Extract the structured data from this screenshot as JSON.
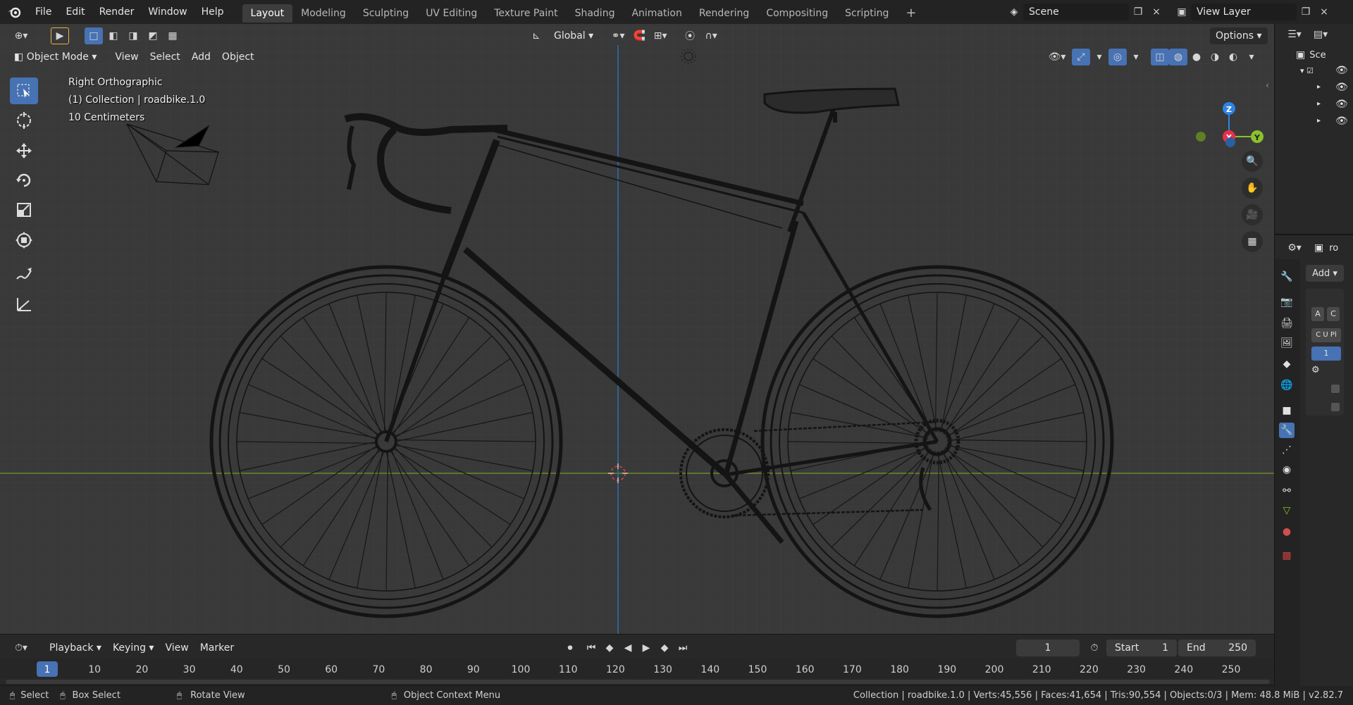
{
  "menu": {
    "file": "File",
    "edit": "Edit",
    "render": "Render",
    "window": "Window",
    "help": "Help"
  },
  "workspaces": [
    "Layout",
    "Modeling",
    "Sculpting",
    "UV Editing",
    "Texture Paint",
    "Shading",
    "Animation",
    "Rendering",
    "Compositing",
    "Scripting"
  ],
  "add_workspace": "+",
  "scene": {
    "label": "Scene",
    "close": "×"
  },
  "view_layer": {
    "label": "View Layer"
  },
  "toolbar": {
    "orientation": "Global",
    "options": "Options"
  },
  "viewport_header": {
    "mode": "Object Mode",
    "view": "View",
    "select": "Select",
    "add": "Add",
    "object": "Object"
  },
  "overlay_text": {
    "view_name": "Right Orthographic",
    "collection": "(1) Collection | roadbike.1.0",
    "scale": "10 Centimeters"
  },
  "gizmo": {
    "x": "X",
    "y": "Y",
    "z": "Z"
  },
  "timeline": {
    "playback": "Playback",
    "keying": "Keying",
    "view": "View",
    "marker": "Marker",
    "current_frame": "1",
    "start_label": "Start",
    "start": "1",
    "end_label": "End",
    "end": "250",
    "frame_labels": [
      "1",
      "10",
      "20",
      "30",
      "40",
      "50",
      "60",
      "70",
      "80",
      "90",
      "100",
      "110",
      "120",
      "130",
      "140",
      "150",
      "160",
      "170",
      "180",
      "190",
      "200",
      "210",
      "220",
      "230",
      "240",
      "250"
    ]
  },
  "status": {
    "select": "Select",
    "box_select": "Box Select",
    "rotate_view": "Rotate View",
    "context_menu": "Object Context Menu",
    "info": "Collection | roadbike.1.0 | Verts:45,556 | Faces:41,654 | Tris:90,554 | Objects:0/3 | Mem: 48.8 MiB | v2.82.7"
  },
  "outliner": {
    "scene_short": "Sce"
  },
  "properties": {
    "object_short": "ro",
    "add": "Add",
    "btn_a": "A",
    "btn_c": "C",
    "btn_cup": "C U Pl",
    "value": "1"
  },
  "colors": {
    "accent": "#4772b3",
    "x_axis": "#e8304a",
    "y_axis": "#8bc02e",
    "z_axis": "#2f84e3",
    "grid_bg": "#393939",
    "wire": "#111111"
  }
}
